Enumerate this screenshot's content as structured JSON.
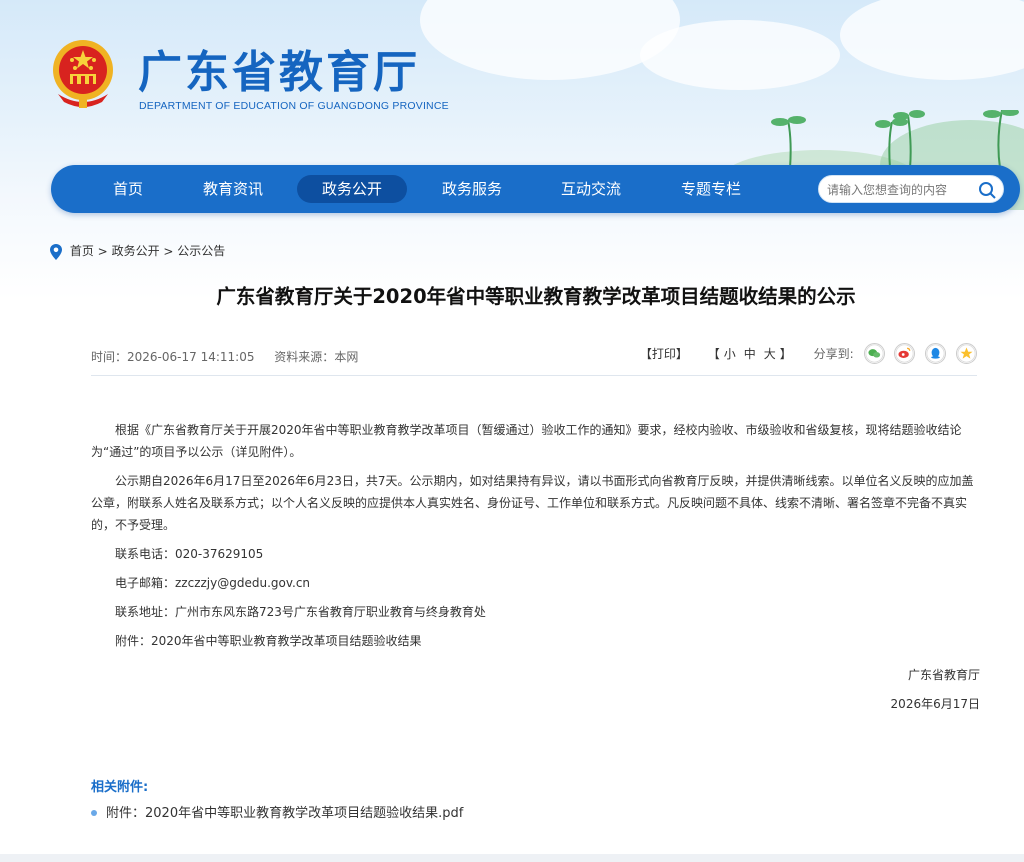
{
  "header": {
    "title": "广东省教育厅",
    "subtitle": "DEPARTMENT OF EDUCATION OF GUANGDONG PROVINCE"
  },
  "nav": {
    "items": [
      {
        "label": "首页"
      },
      {
        "label": "教育资讯"
      },
      {
        "label": "政务公开"
      },
      {
        "label": "政务服务"
      },
      {
        "label": "互动交流"
      },
      {
        "label": "专题专栏"
      }
    ],
    "active_index": 2,
    "search_placeholder": "请输入您想查询的内容"
  },
  "breadcrumb": {
    "items": [
      "首页",
      "政务公开",
      "公示公告"
    ],
    "separator": ">"
  },
  "article": {
    "title": "广东省教育厅关于2020年省中等职业教育教学改革项目结题收结果的公示",
    "time_label": "时间：",
    "time": "2026-06-17 14:11:05",
    "source_label": "资料来源：",
    "source": "本网",
    "print_label": "【打印】",
    "font_open": "【",
    "font_small": "小",
    "font_medium": "中",
    "font_large": "大",
    "font_close": "】",
    "share_label": "分享到:",
    "paragraph1": "根据《广东省教育厅关于开展2020年省中等职业教育教学改革项目（暂缓通过）验收工作的通知》要求，经校内验收、市级验收和省级复核，现将结题验收结论为“通过”的项目予以公示（详见附件）。",
    "paragraph2": "公示期自2026年6月17日至2026年6月23日，共7天。公示期内，如对结果持有异议，请以书面形式向省教育厅反映，并提供清晰线索。以单位名义反映的应加盖公章，附联系人姓名及联系方式；以个人名义反映的应提供本人真实姓名、身份证号、工作单位和联系方式。凡反映问题不具体、线索不清晰、署名签章不完备不真实的，不予受理。",
    "phone": "联系电话：020-37629105",
    "email": "电子邮箱：zzczzjy@gdedu.gov.cn",
    "address": "联系地址：广州市东风东路723号广东省教育厅职业教育与终身教育处",
    "attachment_line": "附件：2020年省中等职业教育教学改革项目结题验收结果",
    "signature": "广东省教育厅",
    "date": "2026年6月17日"
  },
  "attachments": {
    "title": "相关附件:",
    "items": [
      "附件：2020年省中等职业教育教学改革项目结题验收结果.pdf"
    ]
  },
  "colors": {
    "brand_blue": "#1a6ec9",
    "nav_active": "#0d4fa0",
    "wechat": "#4caf50",
    "weibo": "#e53935",
    "qq": "#1e88e5",
    "qzone": "#fbc02d"
  },
  "icons": [
    "national-emblem-icon",
    "search-icon",
    "location-pin-icon",
    "wechat-icon",
    "weibo-icon",
    "qq-icon",
    "qzone-icon"
  ]
}
